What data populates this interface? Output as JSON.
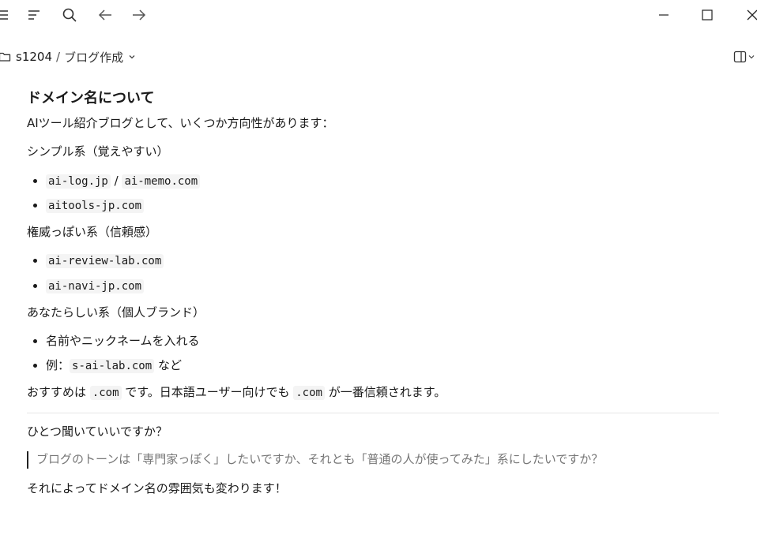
{
  "breadcrumb": {
    "project": "s1204",
    "separator": "/",
    "chat": "ブログ作成"
  },
  "icons": {
    "menu": "hamburger-icon",
    "sidebar": "sidebar-menu-icon",
    "search": "search-icon",
    "back": "arrow-left-icon",
    "forward": "arrow-right-icon",
    "minimize": "minimize-icon",
    "maximize": "maximize-icon",
    "close": "close-icon",
    "folder": "folder-icon",
    "chevron": "chevron-down-icon",
    "panel": "panel-toggle-icon"
  },
  "message": {
    "heading": "ドメイン名について",
    "intro": "AIツール紹介ブログとして、いくつか方向性があります：",
    "section1": {
      "title": "シンプル系（覚えやすい）",
      "item1_a": "ai-log.jp",
      "item1_sep": " / ",
      "item1_b": "ai-memo.com",
      "item2": "aitools-jp.com"
    },
    "section2": {
      "title": "権威っぽい系（信頼感）",
      "item1": "ai-review-lab.com",
      "item2": "ai-navi-jp.com"
    },
    "section3": {
      "title": "あなたらしい系（個人ブランド）",
      "item1": "名前やニックネームを入れる",
      "item2_prefix": "例：",
      "item2_code": "s-ai-lab.com",
      "item2_suffix": " など"
    },
    "recommend": {
      "prefix": "おすすめは ",
      "code1": ".com",
      "middle": " です。日本語ユーザー向けでも ",
      "code2": ".com",
      "suffix": " が一番信頼されます。"
    },
    "question": "ひとつ聞いていいですか？",
    "quote": "ブログのトーンは「専門家っぽく」したいですか、それとも「普通の人が使ってみた」系にしたいですか？",
    "closing": "それによってドメイン名の雰囲気も変わります！"
  }
}
